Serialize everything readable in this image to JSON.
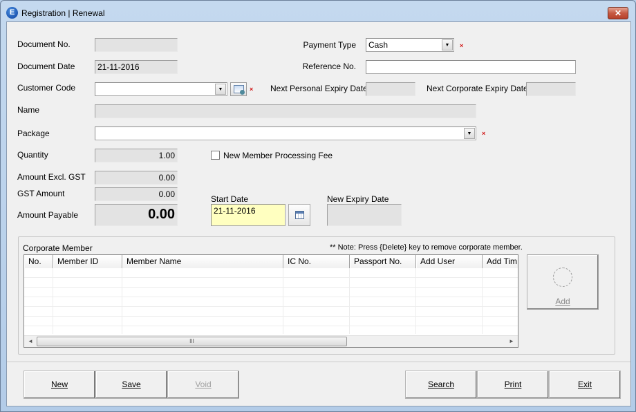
{
  "window": {
    "title": "Registration | Renewal",
    "app_icon_letter": "E",
    "close_glyph": "✕"
  },
  "form": {
    "document_no": {
      "label": "Document No.",
      "value": ""
    },
    "document_date": {
      "label": "Document Date",
      "value": "21-11-2016"
    },
    "customer_code": {
      "label": "Customer Code",
      "value": "",
      "required_mark": "×"
    },
    "name": {
      "label": "Name",
      "value": ""
    },
    "package": {
      "label": "Package",
      "value": "",
      "required_mark": "×"
    },
    "quantity": {
      "label": "Quantity",
      "value": "1.00"
    },
    "amount_excl_gst": {
      "label": "Amount Excl. GST",
      "value": "0.00"
    },
    "gst_amount": {
      "label": "GST Amount",
      "value": "0.00"
    },
    "amount_payable": {
      "label": "Amount Payable",
      "value": "0.00"
    },
    "payment_type": {
      "label": "Payment Type",
      "value": "Cash",
      "required_mark": "×"
    },
    "reference_no": {
      "label": "Reference No.",
      "value": ""
    },
    "next_personal_expiry": {
      "label": "Next Personal Expiry Date",
      "value": ""
    },
    "next_corporate_expiry": {
      "label": "Next Corporate Expiry Date",
      "value": ""
    },
    "new_member_fee": {
      "label": "New Member Processing Fee",
      "checked": false
    },
    "start_date": {
      "label": "Start Date",
      "value": "21-11-2016"
    },
    "new_expiry_date": {
      "label": "New Expiry Date",
      "value": ""
    },
    "dropdown_glyph": "▼"
  },
  "corporate": {
    "title": "Corporate Member",
    "note": "** Note: Press {Delete} key to remove corporate member.",
    "columns": [
      "No.",
      "Member ID",
      "Member Name",
      "IC No.",
      "Passport No.",
      "Add User",
      "Add Tim"
    ],
    "rows": [],
    "scroll_left": "◄",
    "scroll_right": "►",
    "scroll_grip": "III",
    "add_button": "Add"
  },
  "buttons": {
    "new": "New",
    "save": "Save",
    "void": "Void",
    "search": "Search",
    "print": "Print",
    "exit": "Exit"
  }
}
